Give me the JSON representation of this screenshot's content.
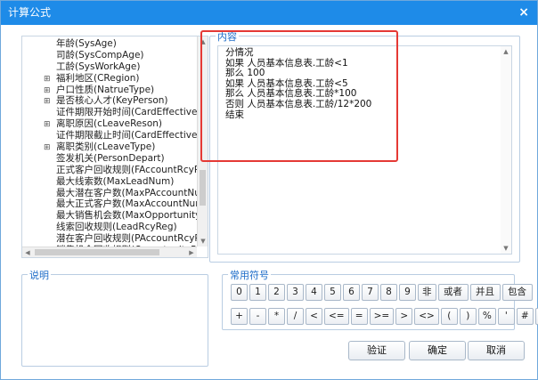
{
  "title": "计算公式",
  "close_glyph": "×",
  "tree": {
    "items": [
      {
        "prefix": "",
        "label": "年龄(SysAge)"
      },
      {
        "prefix": "",
        "label": "司龄(SysCompAge)"
      },
      {
        "prefix": "",
        "label": "工龄(SysWorkAge)"
      },
      {
        "prefix": "⊞",
        "label": "福利地区(CRegion)"
      },
      {
        "prefix": "⊞",
        "label": "户口性质(NatrueType)"
      },
      {
        "prefix": "⊞",
        "label": "是否核心人才(KeyPerson)"
      },
      {
        "prefix": "",
        "label": "证件期限开始时间(CardEffectiveBeg"
      },
      {
        "prefix": "⊞",
        "label": "离职原因(cLeaveReson)"
      },
      {
        "prefix": "",
        "label": "证件期限截止时间(CardEffectiveEnd"
      },
      {
        "prefix": "⊞",
        "label": "离职类别(cLeaveType)"
      },
      {
        "prefix": "",
        "label": "签发机关(PersonDepart)"
      },
      {
        "prefix": "",
        "label": "正式客户回收规则(FAccountRcyReg"
      },
      {
        "prefix": "",
        "label": "最大线索数(MaxLeadNum)"
      },
      {
        "prefix": "",
        "label": "最大潜在客户数(MaxPAccountNum)"
      },
      {
        "prefix": "",
        "label": "最大正式客户数(MaxAccountNum)"
      },
      {
        "prefix": "",
        "label": "最大销售机会数(MaxOpportunityNur"
      },
      {
        "prefix": "",
        "label": "线索回收规则(LeadRcyReg)"
      },
      {
        "prefix": "",
        "label": "潜在客户回收规则(PAccountRcyReg"
      },
      {
        "prefix": "",
        "label": "销售机会回收规则(OpportunityRcyR"
      }
    ]
  },
  "content": {
    "legend": "内容",
    "lines": [
      "分情况",
      "如果 人员基本信息表.工龄<1",
      "那么 100",
      "如果 人员基本信息表.工龄<5",
      "那么 人员基本信息表.工龄*100",
      "否则 人员基本信息表.工龄/12*200",
      "结束"
    ]
  },
  "description": {
    "legend": "说明"
  },
  "symbols": {
    "legend": "常用符号",
    "row1": [
      "0",
      "1",
      "2",
      "3",
      "4",
      "5",
      "6",
      "7",
      "8",
      "9",
      "非",
      "或者",
      "并且",
      "包含"
    ],
    "row2": [
      "+",
      "-",
      "*",
      "/",
      "<",
      "<=",
      "=",
      ">=",
      ">",
      "<>",
      "(",
      ")",
      "%",
      "'",
      "#",
      "{}"
    ]
  },
  "buttons": {
    "verify": "验证",
    "ok": "确定",
    "cancel": "取消"
  }
}
